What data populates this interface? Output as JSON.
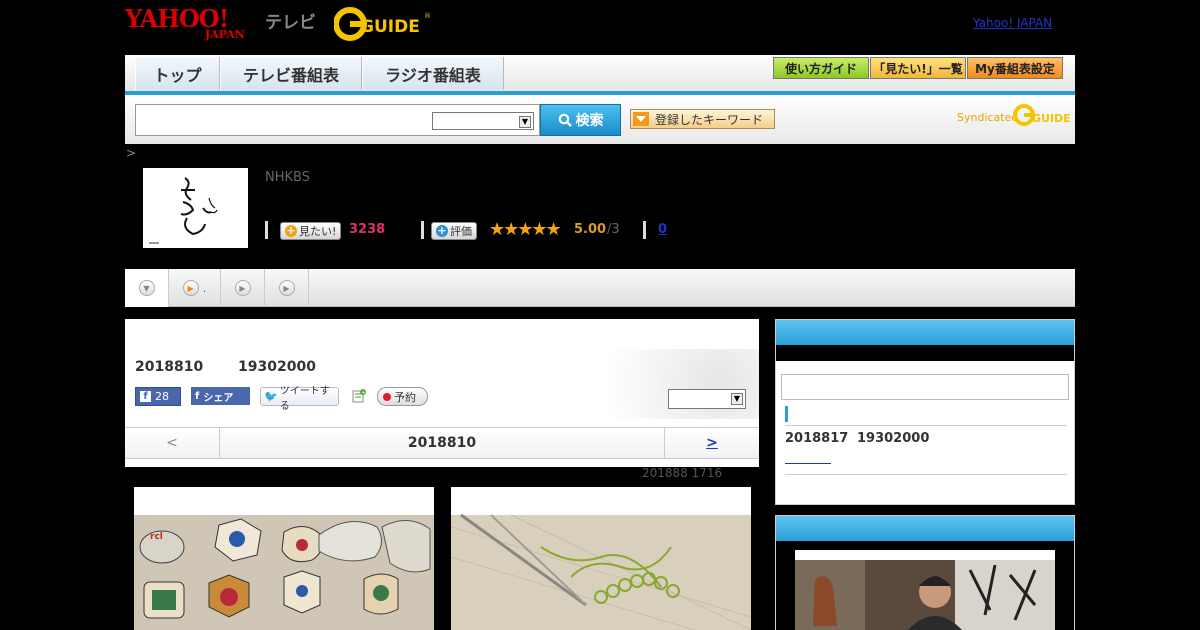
{
  "header": {
    "logo_main": "YAHOO!",
    "logo_sub": "JAPAN",
    "tv_label": "テレビ",
    "gguide_label": "GUIDE",
    "top_link": "Yahoo! JAPAN"
  },
  "nav": {
    "tabs": [
      "トップ",
      "テレビ番組表",
      "ラジオ番組表"
    ],
    "guide_button": "使い方ガイド",
    "mitai_button": "「見たい!」一覧",
    "my_button": "My番組表設定"
  },
  "search": {
    "button_label": "検索",
    "keyword_button": "登録したキーワード",
    "syndicated_label": "Syndicated"
  },
  "breadcrumb": {
    "text": ">"
  },
  "program": {
    "channel": "NHKBS",
    "mitai_label": "見たい!",
    "mitai_count": "3238",
    "rate_label": "評価",
    "stars": "★★★★★",
    "rating": "5.00",
    "rating_count": "/3",
    "review_count": "0"
  },
  "tabs": {
    "items": [
      "",
      ".",
      "",
      ""
    ]
  },
  "detail": {
    "air_date": "2018810",
    "air_time": "19302000",
    "fb_like_count": "28",
    "fb_share_label": "シェア",
    "tweet_label": "ツイートする",
    "reserve_label": "予約",
    "pager_prev": "<",
    "pager_date": "2018810",
    "pager_next": ">",
    "update_note": "201888  1716"
  },
  "sidebar": {
    "rebroadcast_date": "2018817",
    "rebroadcast_time": "19302000"
  },
  "colors": {
    "accent_blue": "#2a9fd8",
    "yahoo_red": "#d90000",
    "gguide_yellow": "#f5c400",
    "mitai_pink": "#e0306a",
    "star_orange": "#f3a514"
  }
}
